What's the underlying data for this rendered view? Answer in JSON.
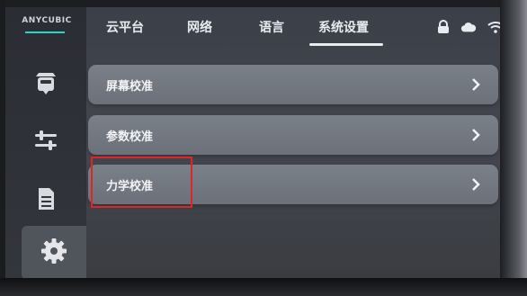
{
  "brand": {
    "name": "ANYCUBIC",
    "accent": "#2fd3c3"
  },
  "sidebar": {
    "items": [
      {
        "icon": "printer-head-icon"
      },
      {
        "icon": "sliders-icon"
      },
      {
        "icon": "file-icon"
      },
      {
        "icon": "gear-icon",
        "active": true
      }
    ]
  },
  "tabs": [
    {
      "label": "云平台"
    },
    {
      "label": "网络"
    },
    {
      "label": "语言"
    },
    {
      "label": "系统设置",
      "active": true
    }
  ],
  "status_icons": [
    "lock-icon",
    "cloud-icon",
    "wifi-icon"
  ],
  "menu": [
    {
      "label": "屏幕校准"
    },
    {
      "label": "参数校准"
    },
    {
      "label": "力学校准",
      "highlighted": true
    }
  ],
  "colors": {
    "highlight": "#e0242b"
  }
}
